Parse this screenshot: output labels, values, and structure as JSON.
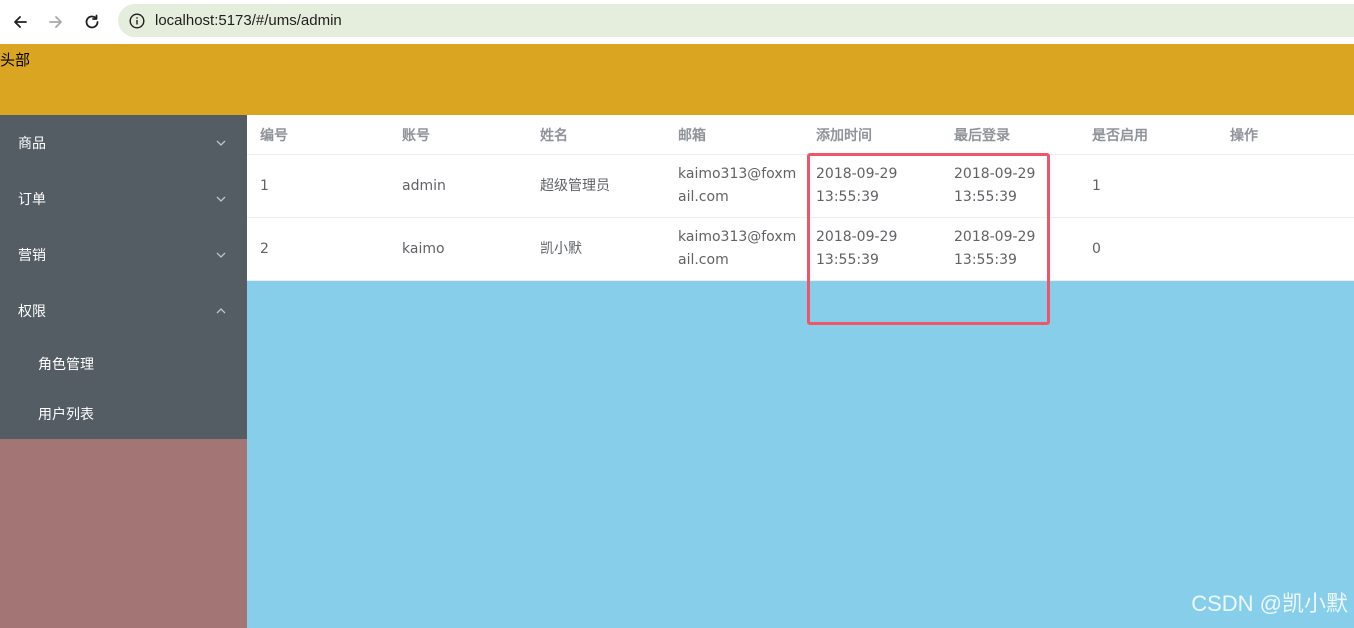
{
  "browser": {
    "url": "localhost:5173/#/ums/admin"
  },
  "header": {
    "title": "头部"
  },
  "sidebar": {
    "menus": [
      {
        "label": "商品",
        "expanded": false
      },
      {
        "label": "订单",
        "expanded": false
      },
      {
        "label": "营销",
        "expanded": false
      },
      {
        "label": "权限",
        "expanded": true
      }
    ],
    "submenu": [
      {
        "label": "角色管理"
      },
      {
        "label": "用户列表"
      }
    ]
  },
  "table": {
    "columns": [
      "编号",
      "账号",
      "姓名",
      "邮箱",
      "添加时间",
      "最后登录",
      "是否启用",
      "操作"
    ],
    "rows": [
      {
        "id": "1",
        "account": "admin",
        "name": "超级管理员",
        "email": "kaimo313@foxmail.com",
        "created": "2018-09-29 13:55:39",
        "last_login": "2018-09-29 13:55:39",
        "enabled": "1",
        "action": ""
      },
      {
        "id": "2",
        "account": "kaimo",
        "name": "凯小默",
        "email": "kaimo313@foxmail.com",
        "created": "2018-09-29 13:55:39",
        "last_login": "2018-09-29 13:55:39",
        "enabled": "0",
        "action": ""
      }
    ]
  },
  "watermark": "CSDN @凯小默",
  "colors": {
    "header": "#daa520",
    "sidebar_menu": "#545c64",
    "sidebar_bg": "#a37574",
    "main_bg": "#87ceeb",
    "highlight": "#f0566a"
  }
}
